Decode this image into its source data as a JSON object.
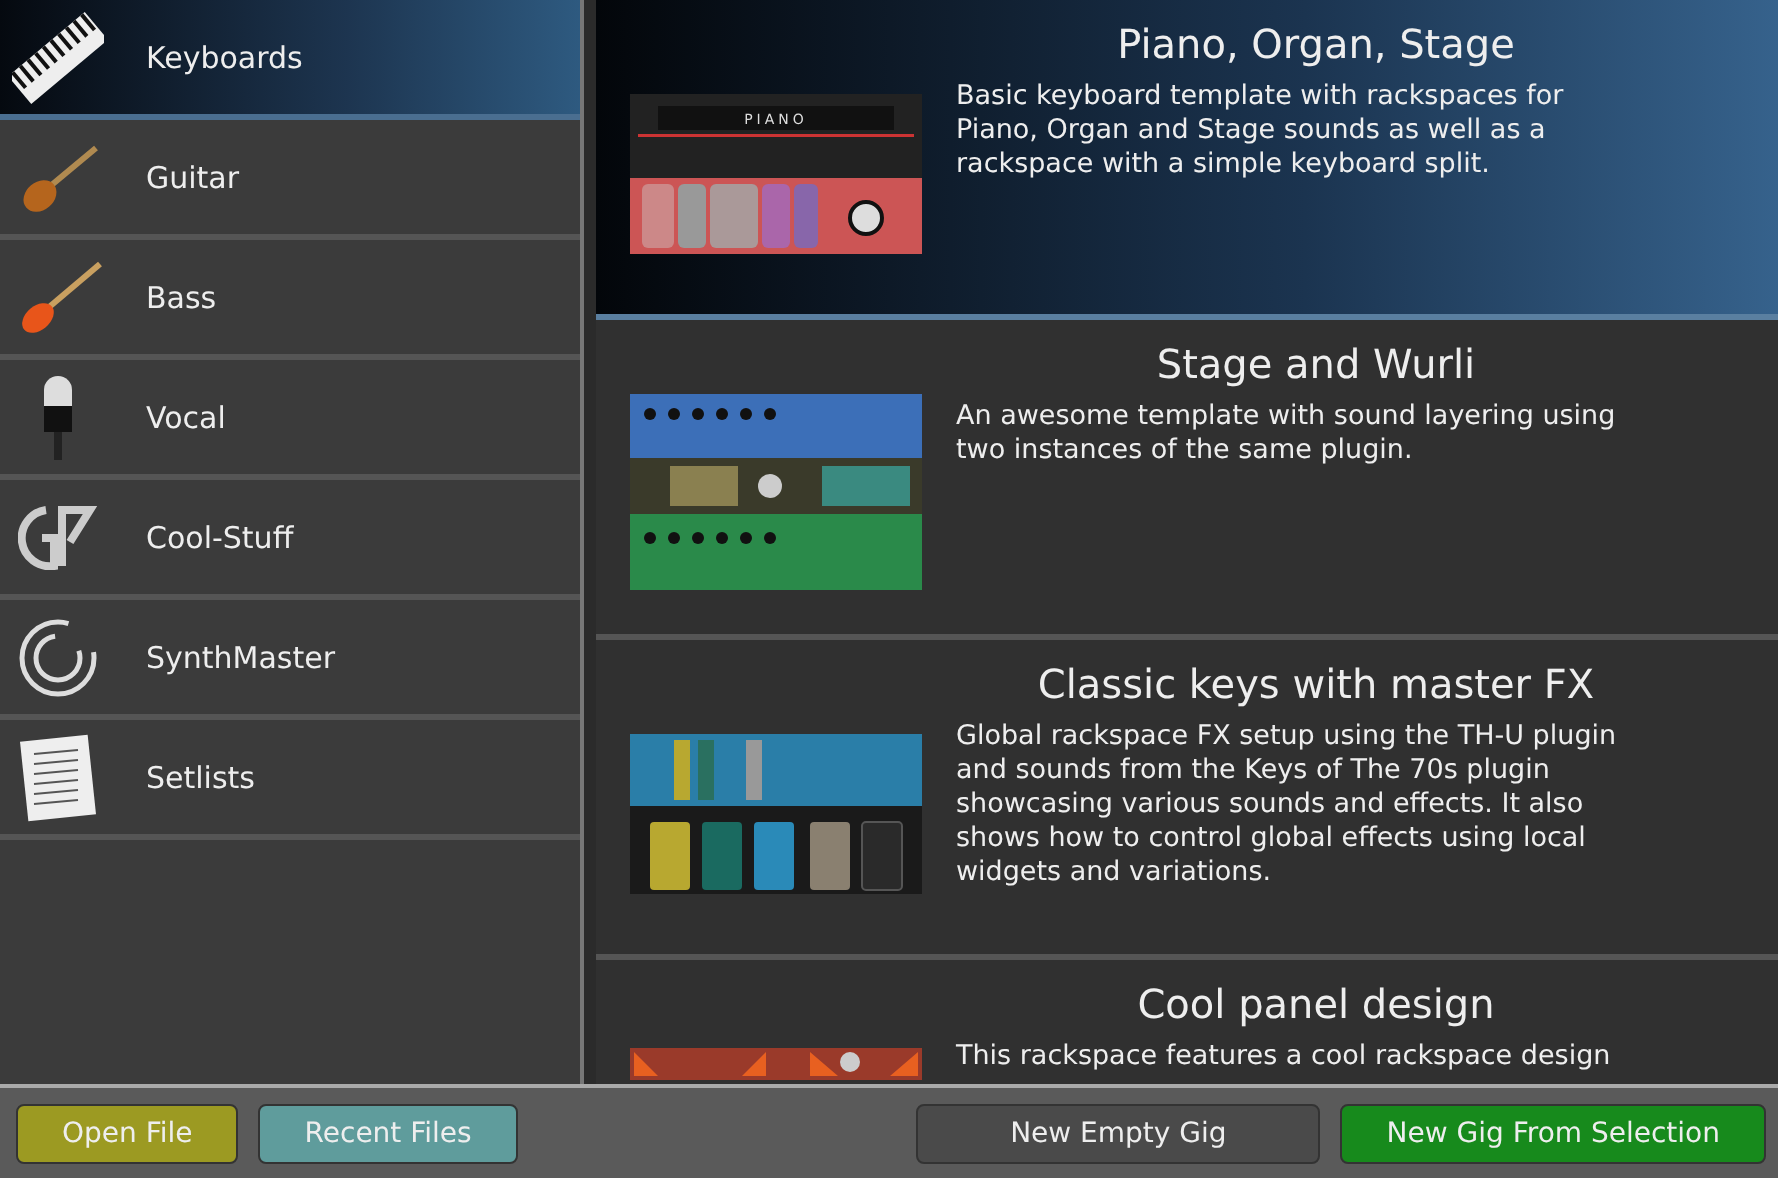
{
  "sidebar": {
    "items": [
      {
        "label": "Keyboards",
        "kind": "keyboard",
        "selected": true
      },
      {
        "label": "Guitar",
        "kind": "guitar",
        "selected": false
      },
      {
        "label": "Bass",
        "kind": "bass",
        "selected": false
      },
      {
        "label": "Vocal",
        "kind": "microphone",
        "selected": false
      },
      {
        "label": "Cool-Stuff",
        "kind": "monogram",
        "selected": false
      },
      {
        "label": "SynthMaster",
        "kind": "rings",
        "selected": false
      },
      {
        "label": "Setlists",
        "kind": "paper",
        "selected": false
      }
    ]
  },
  "templates": [
    {
      "title": "Piano, Organ, Stage",
      "description": "Basic keyboard template with rackspaces for Piano, Organ and Stage sounds as well as a rackspace with a simple keyboard split.",
      "kind": "piano",
      "panel_label": "PIANO",
      "selected": true
    },
    {
      "title": "Stage and Wurli",
      "description": "An awesome template with sound layering using two instances of the same plugin.",
      "kind": "layered",
      "selected": false
    },
    {
      "title": "Classic keys with master FX",
      "description": "Global rackspace FX setup using the TH-U plugin and sounds from the Keys of The 70s plugin showcasing various sounds and effects. It also shows how to control global effects using local widgets and variations.",
      "kind": "pedals",
      "selected": false
    },
    {
      "title": "Cool panel design",
      "description": "This rackspace features a cool rackspace design",
      "kind": "orange",
      "selected": false
    }
  ],
  "buttons": [
    {
      "label": "Open File",
      "color": "#9c9a22"
    },
    {
      "label": "Recent Files",
      "color": "#5f9c9c"
    },
    {
      "label": "New Empty Gig",
      "color": "#4a4a4a"
    },
    {
      "label": "New Gig From Selection",
      "color": "#178a1c"
    }
  ]
}
